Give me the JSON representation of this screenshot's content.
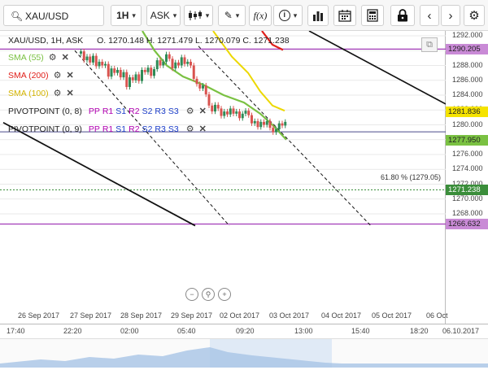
{
  "toolbar": {
    "symbol": "XAU/USD",
    "timeframe": "1H",
    "price_type": "ASK",
    "fx_label": "f(x)"
  },
  "legend": {
    "text": "XAU/USD, 1H, ASK",
    "ohlc": "O. 1270.148  H. 1271.479  L. 1270.079  C. 1271.238"
  },
  "indicators": [
    {
      "label": "SMA (55)",
      "color": "#7ac142"
    },
    {
      "label": "SMA (200)",
      "color": "#e0201b"
    },
    {
      "label": "SMA (100)",
      "color": "#e6c300"
    },
    {
      "label": "PIVOTPOINT (0, 8)",
      "color": "#222222"
    },
    {
      "label": "PIVOTPOINT (0, 9)",
      "color": "#222222"
    }
  ],
  "pivot_labels": [
    "PP",
    "R1",
    "S1",
    "R2",
    "S2",
    "R3",
    "S3"
  ],
  "pivot_colors": [
    "#b000b0",
    "#b000b0",
    "#1a3cc8",
    "#b000b0",
    "#1a3cc8",
    "#1a3cc8",
    "#1a3cc8"
  ],
  "price_axis": {
    "ticks": [
      "1292.000",
      "1290.000",
      "1288.000",
      "1286.000",
      "1284.000",
      "1282.000",
      "1280.000",
      "1278.000",
      "1276.000",
      "1274.000",
      "1272.000",
      "1270.000",
      "1268.000"
    ],
    "badges": [
      {
        "text": "1290.205",
        "bg": "#c98ad6",
        "fg": "#222"
      },
      {
        "text": "1281.836",
        "bg": "#f5e300",
        "fg": "#222"
      },
      {
        "text": "1277.950",
        "bg": "#7ac142",
        "fg": "#222"
      },
      {
        "text": "1271.238",
        "bg": "#3b8e3b",
        "fg": "#fff"
      },
      {
        "text": "1266.632",
        "bg": "#c98ad6",
        "fg": "#222"
      }
    ]
  },
  "fib_label": "61.80 % (1279.05)",
  "dates": [
    "26 Sep 2017",
    "27 Sep 2017",
    "28 Sep 2017",
    "29 Sep 2017",
    "02 Oct 2017",
    "03 Oct 2017",
    "04 Oct 2017",
    "05 Oct 2017",
    "06 Oct"
  ],
  "times": [
    "17:40",
    "22:20",
    "02:00",
    "05:40",
    "09:20",
    "13:00",
    "15:40",
    "18:20",
    "06.10.2017"
  ],
  "colors": {
    "up": "#2e8b57",
    "down": "#d9534f",
    "grid": "#e9e9e9"
  }
}
